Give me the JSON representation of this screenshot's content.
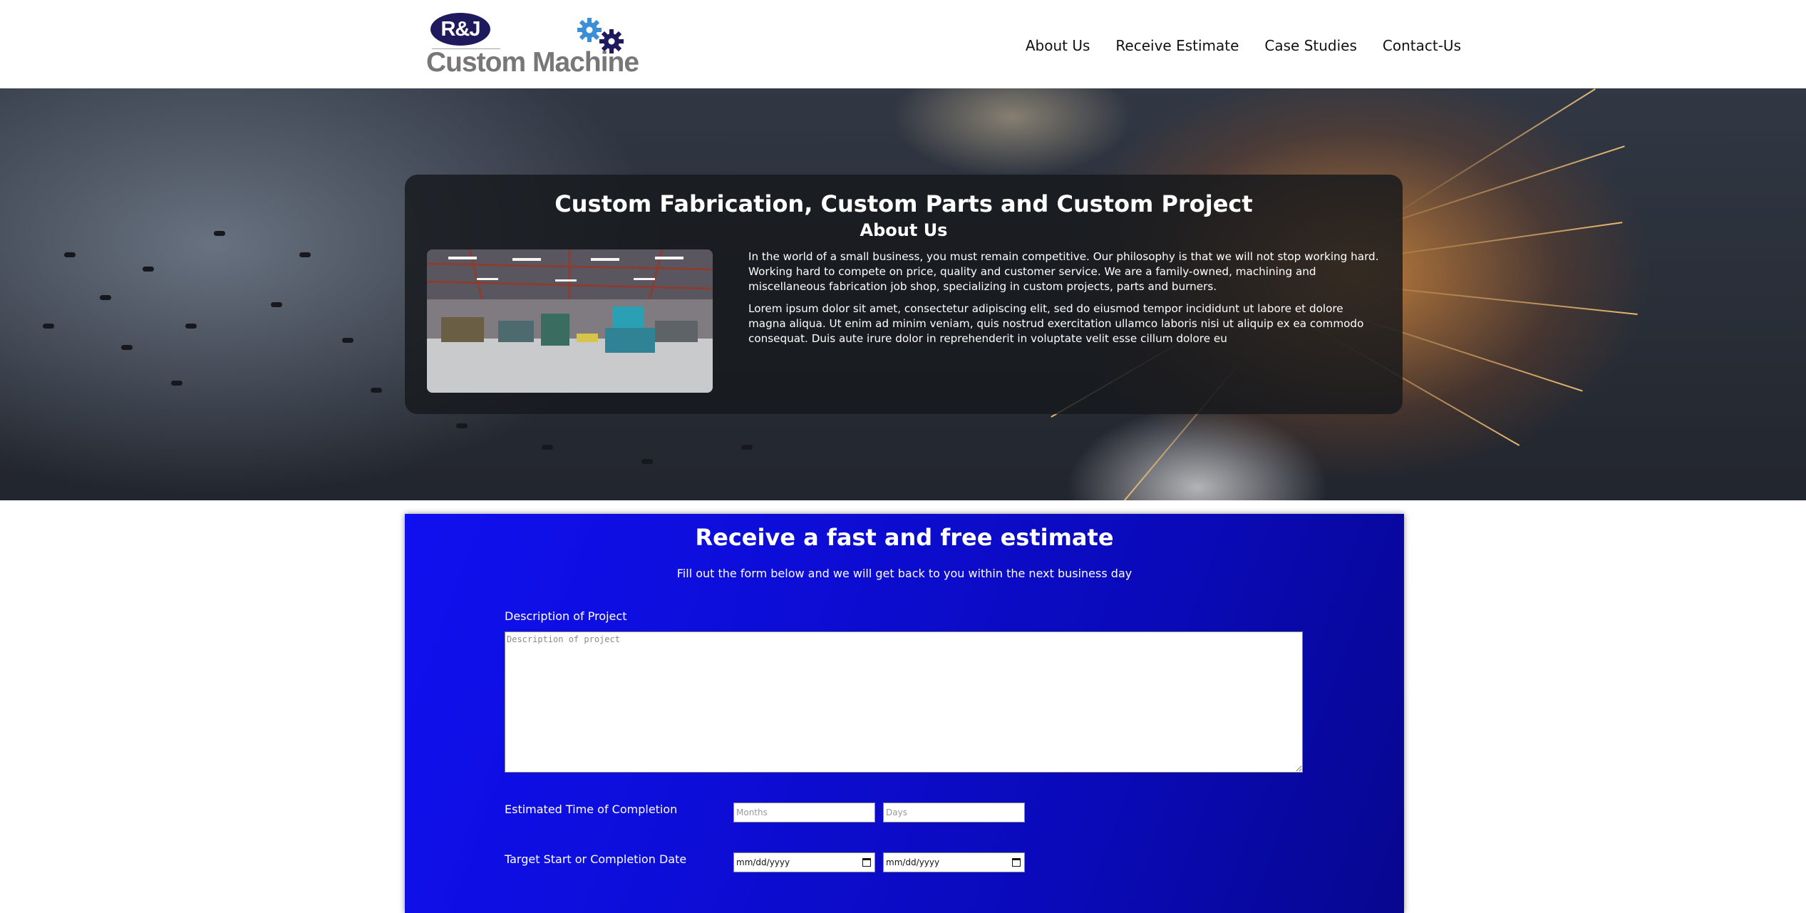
{
  "brand": {
    "logo_badge": "R&J",
    "logo_text": "Custom Machine"
  },
  "nav": {
    "items": [
      {
        "label": "About Us"
      },
      {
        "label": "Receive Estimate"
      },
      {
        "label": "Case Studies"
      },
      {
        "label": "Contact-Us"
      }
    ]
  },
  "hero": {
    "title": "Custom Fabrication, Custom Parts and Custom Project",
    "subtitle": "About Us",
    "paragraphs": [
      "In the world of a small business, you must remain competitive. Our philosophy is that we will not stop working hard. Working hard to compete on price, quality and customer service. We are a family-owned, machining and miscellaneous fabrication job shop, specializing in custom projects, parts and burners.",
      "Lorem ipsum dolor sit amet, consectetur adipiscing elit, sed do eiusmod tempor incididunt ut labore et dolore magna aliqua. Ut enim ad minim veniam, quis nostrud exercitation ullamco laboris nisi ut aliquip ex ea commodo consequat. Duis aute irure dolor in reprehenderit in voluptate velit esse cillum dolore eu"
    ]
  },
  "estimate": {
    "title": "Receive a fast and free estimate",
    "subtitle": "Fill out the form below and we will get back to you within the next business day",
    "description_label": "Description of Project",
    "description_placeholder": "Description of project",
    "time_label": "Estimated Time of Completion",
    "months_placeholder": "Months",
    "days_placeholder": "Days",
    "date_label": "Target Start or Completion Date",
    "date_start_value": "mm/dd/yyyy",
    "date_end_value": "mm/dd/yyyy"
  },
  "colors": {
    "estimate_bg": "#0d0dd8",
    "logo_navy": "#1f1a5e",
    "gear_blue": "#3b8fd6"
  }
}
